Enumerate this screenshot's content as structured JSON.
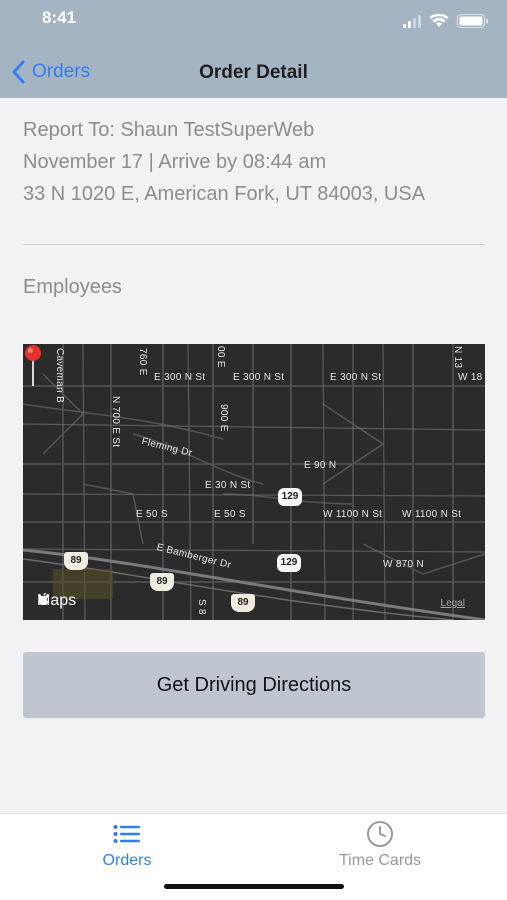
{
  "status_bar": {
    "time": "8:41"
  },
  "nav": {
    "back_label": "Orders",
    "title": "Order Detail"
  },
  "order": {
    "report_to": "Report To: Shaun TestSuperWeb",
    "schedule": "November 17 | Arrive by 08:44 am",
    "address": "33 N 1020 E, American Fork, UT 84003, USA"
  },
  "employees_label": "Employees",
  "map": {
    "streets": [
      "Caveman B",
      "760 E",
      "00 E",
      "E 300 N St",
      "E 300 N St",
      "E 300 N St",
      "W 18",
      "N 700 E St",
      "900 E",
      "Fleming Dr",
      "E 90 N",
      "E 30 N St",
      "E 50 S",
      "E 50 S",
      "W 1100 N St",
      "W 1100 N St",
      "E Bamberger Dr",
      "W 870 N",
      "N 13",
      "S 8"
    ],
    "shields": [
      "129",
      "129",
      "89",
      "89",
      "89"
    ],
    "logo": "Maps",
    "legal": "Legal",
    "pin_color": "#e8302c"
  },
  "directions_button": "Get Driving Directions",
  "tabbar": {
    "orders_label": "Orders",
    "timecards_label": "Time Cards",
    "active_color": "#2f7ff2"
  }
}
